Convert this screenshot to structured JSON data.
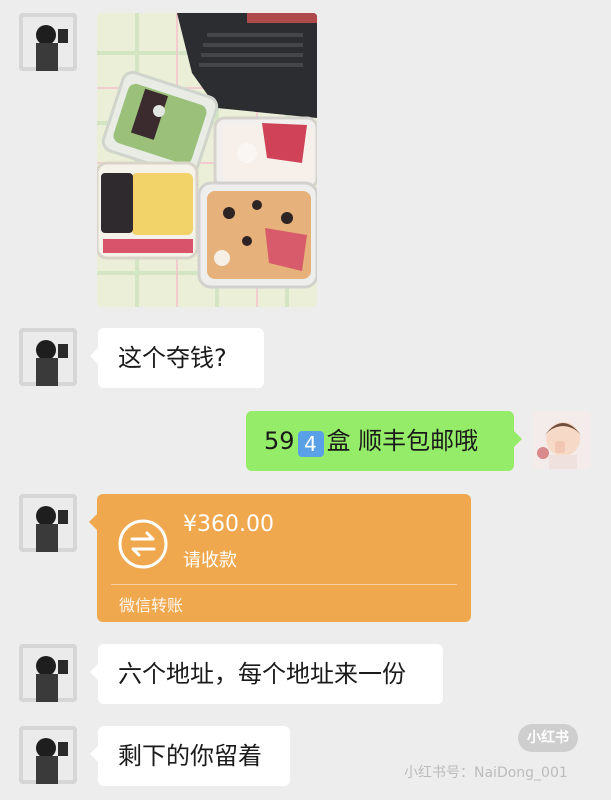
{
  "chat": {
    "messages": [
      {
        "sender": "other",
        "type": "image"
      },
      {
        "sender": "other",
        "type": "text",
        "text": "这个夺钱?"
      },
      {
        "sender": "self",
        "type": "text",
        "text_before": "59",
        "keycap": "4",
        "text_after": "盒 顺丰包邮哦"
      },
      {
        "sender": "other",
        "type": "transfer",
        "amount": "¥360.00",
        "status": "请收款",
        "footer": "微信转账"
      },
      {
        "sender": "other",
        "type": "text",
        "text": "六个地址，每个地址来一份"
      },
      {
        "sender": "other",
        "type": "text",
        "text": "剩下的你留着"
      }
    ]
  },
  "watermark": {
    "logo": "小红书",
    "id": "小红书号：NaiDong_001"
  },
  "colors": {
    "background": "#ededed",
    "incoming_bubble": "#ffffff",
    "outgoing_bubble": "#95ec69",
    "transfer_card": "#f0a84f"
  }
}
